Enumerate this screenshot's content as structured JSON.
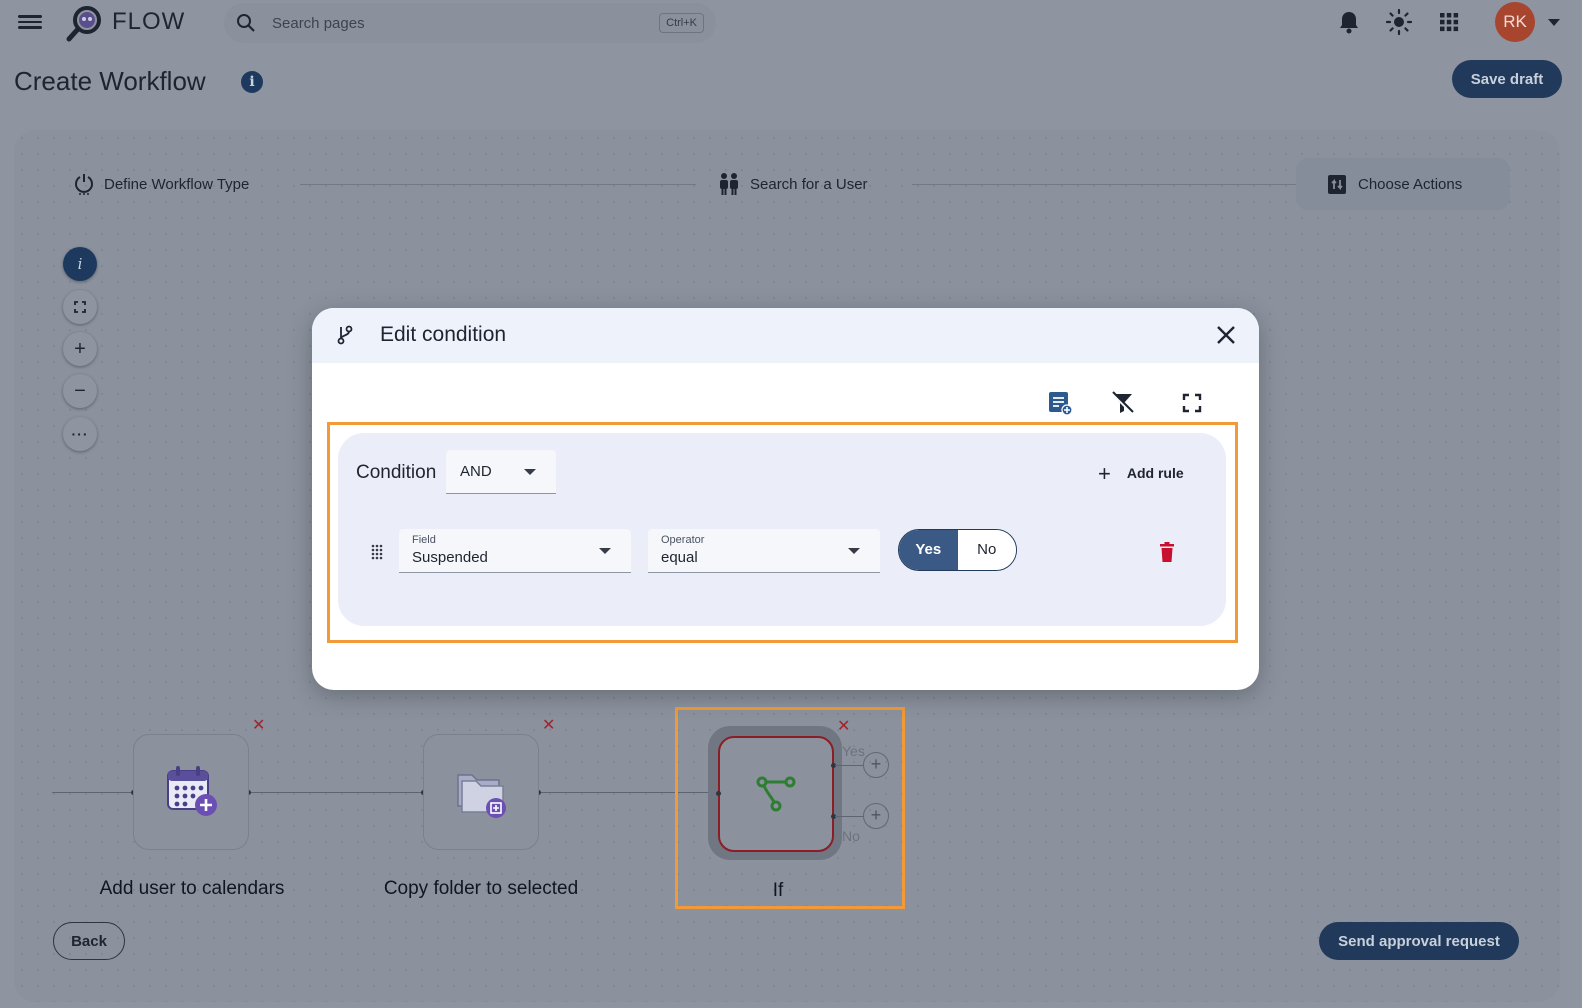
{
  "app": {
    "brand": "FLOW"
  },
  "search": {
    "placeholder": "Search pages",
    "shortcut": "Ctrl+K"
  },
  "user": {
    "initials": "RK",
    "avatar_color": "#a7452f"
  },
  "page": {
    "title": "Create Workflow",
    "save_label": "Save draft"
  },
  "stepper": {
    "steps": [
      {
        "label": "Define Workflow Type"
      },
      {
        "label": "Search for a User"
      },
      {
        "label": "Choose Actions"
      }
    ]
  },
  "canvas": {
    "controls": [
      "info",
      "fit-view",
      "zoom-in",
      "zoom-out",
      "more"
    ],
    "nodes": [
      {
        "label": "Add user to calendars",
        "icon": "calendar-add-icon"
      },
      {
        "label": "Copy folder to selected",
        "icon": "folder-copy-icon"
      },
      {
        "label": "If",
        "icon": "branch-icon"
      }
    ],
    "branches": {
      "yes": "Yes",
      "no": "No"
    },
    "remove_symbol": "✕"
  },
  "footer": {
    "back_label": "Back",
    "approval_label": "Send approval request"
  },
  "modal": {
    "title": "Edit condition",
    "condition": {
      "label": "Condition",
      "combinator": "AND",
      "add_rule_label": "Add rule",
      "rules": [
        {
          "field_label": "Field",
          "field_value": "Suspended",
          "operator_label": "Operator",
          "operator_value": "equal",
          "value_options": [
            "Yes",
            "No"
          ],
          "value_selected": "Yes"
        }
      ]
    }
  },
  "colors": {
    "accent": "#21395a",
    "highlight": "#f29a38",
    "danger": "#c8102e",
    "if_node_border": "#8c1d25",
    "branch_icon": "#2e7d32"
  }
}
